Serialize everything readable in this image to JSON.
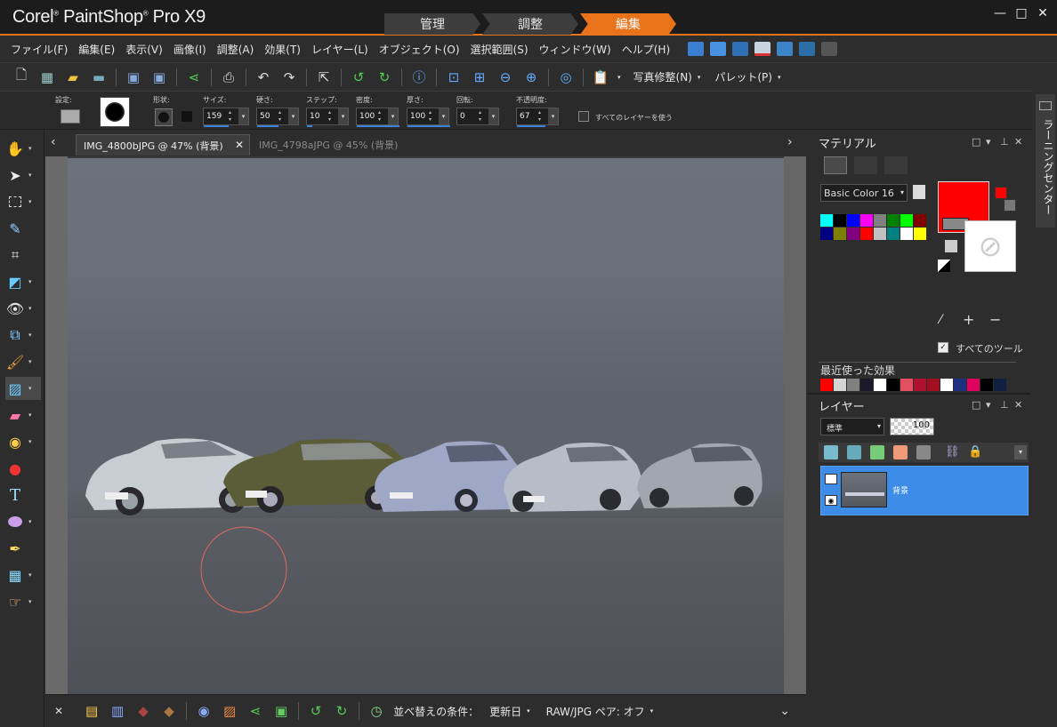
{
  "app": {
    "title_corel": "Corel",
    "title_rest": "PaintShop",
    "title_pro": "Pro X9"
  },
  "workspace_tabs": [
    "管理",
    "調整",
    "編集"
  ],
  "window_controls": {
    "minimize": "—",
    "maximize": "□",
    "close": "✕"
  },
  "menu": [
    "ファイル(F)",
    "編集(E)",
    "表示(V)",
    "画像(I)",
    "調整(A)",
    "効果(T)",
    "レイヤー(L)",
    "オブジェクト(O)",
    "選択範囲(S)",
    "ウィンドウ(W)",
    "ヘルプ(H)"
  ],
  "toolbar": {
    "photo_fix_label": "写真修整(N)",
    "palette_label": "パレット(P)"
  },
  "options": {
    "preset_label": "設定:",
    "shape_label": "形状:",
    "size_label": "サイズ:",
    "size_value": "159",
    "hardness_label": "硬さ:",
    "hardness_value": "50",
    "step_label": "ステップ:",
    "step_value": "10",
    "density_label": "密度:",
    "density_value": "100",
    "thickness_label": "厚さ:",
    "thickness_value": "100",
    "rotation_label": "回転:",
    "rotation_value": "0",
    "opacity_label": "不透明度:",
    "opacity_value": "67",
    "use_all_layers_label": "すべてのレイヤーを使う"
  },
  "tabs": [
    {
      "label": "IMG_4800bJPG @   47% (背景)",
      "active": true
    },
    {
      "label": "IMG_4798aJPG @   45% (背景)",
      "active": false
    }
  ],
  "organizer": {
    "sort_label": "並べ替えの条件：",
    "sort_value": "更新日",
    "raw_pair_label": "RAW/JPG ペア: オフ"
  },
  "materials": {
    "title": "マテリアル",
    "palette_select": "Basic Color 16",
    "foreground_color": "#ff0000",
    "all_tools_label": "すべてのツール",
    "recent_effects_label": "最近使った効果",
    "palette_colors": [
      "#00ffff",
      "#000000",
      "#0000ff",
      "#ff00ff",
      "#808080",
      "#008000",
      "#00ff00",
      "#800000",
      "#000080",
      "#808000",
      "#800080",
      "#ff0000",
      "#c0c0c0",
      "#008080",
      "#ffffff",
      "#ffff00"
    ],
    "recent_colors": [
      "#ff0000",
      "#d3d3d3",
      "#808080",
      "#1a1a2a",
      "#ffffff",
      "#000000",
      "#e05060",
      "#b01030",
      "#a01020",
      "#ffffff",
      "#203080",
      "#e00060",
      "#000000",
      "#102040"
    ]
  },
  "layers": {
    "title": "レイヤー",
    "blend_mode": "標準",
    "opacity": "100",
    "layer_name": "背景"
  },
  "learning_center": {
    "label": "ラーニングセンター"
  }
}
